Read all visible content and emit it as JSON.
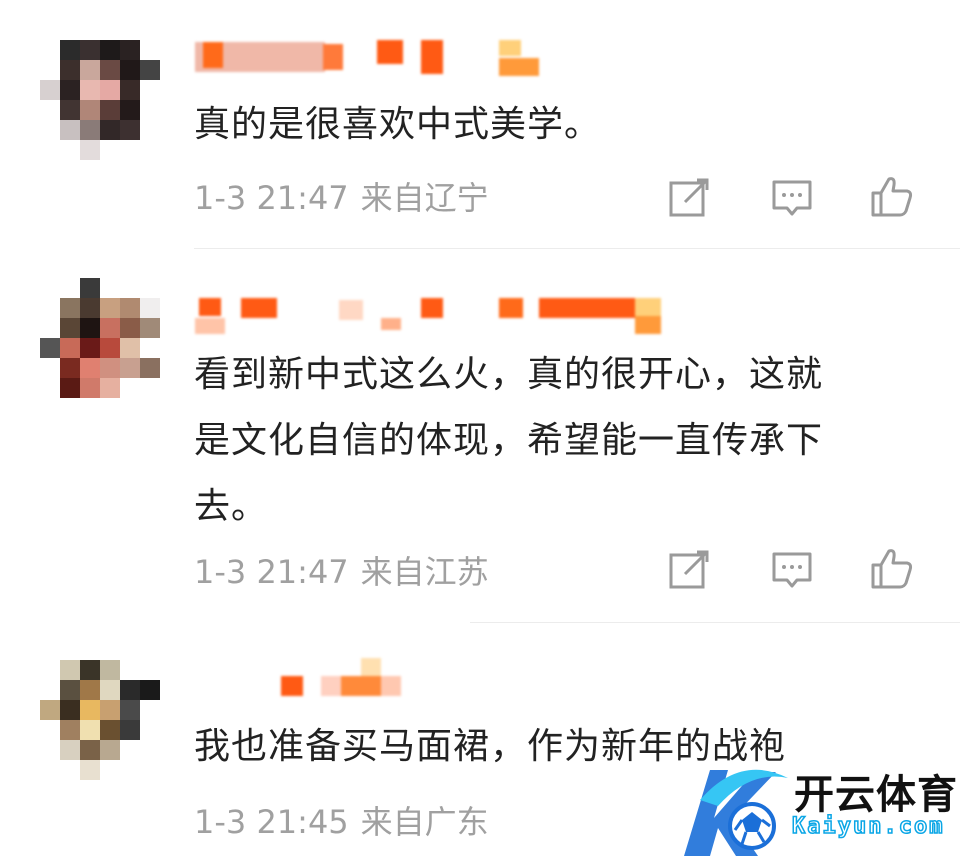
{
  "comments": [
    {
      "text": "真的是很喜欢中式美学。",
      "time": "1-3 21:47",
      "location": "来自辽宁",
      "actions": [
        "share-icon",
        "comment-icon",
        "like-icon"
      ]
    },
    {
      "text": "看到新中式这么火，真的很开心，这就\n是文化自信的体现，希望能一直传承下\n去。",
      "time": "1-3 21:47",
      "location": "来自江苏",
      "actions": [
        "share-icon",
        "comment-icon",
        "like-icon"
      ]
    },
    {
      "text": "我也准备买马面裙，作为新年的战袍",
      "time": "1-3 21:45",
      "location": "来自广东",
      "actions": [
        "share-icon",
        "comment-icon",
        "like-icon"
      ]
    }
  ],
  "watermark": {
    "name_cn": "开云体育",
    "name_en": "Kaiyun.com"
  },
  "colors": {
    "text": "#222222",
    "meta": "#a0a0a0",
    "icon": "#9a9a9a",
    "name_blur": "#ff6a1a",
    "watermark_blue": "#0aa6e6"
  }
}
